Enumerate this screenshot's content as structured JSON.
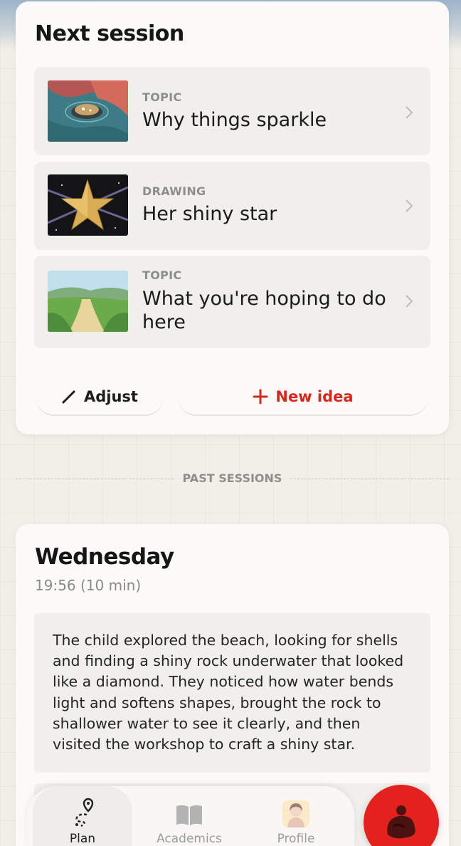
{
  "next_session": {
    "title": "Next session",
    "items": [
      {
        "kind": "TOPIC",
        "title": "Why things sparkle"
      },
      {
        "kind": "DRAWING",
        "title": "Her shiny star"
      },
      {
        "kind": "TOPIC",
        "title": "What you're hoping to do here"
      }
    ],
    "adjust_label": "Adjust",
    "new_idea_label": "New idea"
  },
  "past_sessions": {
    "label": "PAST SESSIONS",
    "sessions": [
      {
        "day": "Wednesday",
        "time": "19:56 (10 min)",
        "summary": "The child explored the beach, looking for shells and finding a shiny rock underwater that looked like a diamond. They noticed how water bends light and softens shapes, brought the rock to shallower water to see it clearly, and then visited the workshop to craft a shiny star."
      }
    ]
  },
  "nav": {
    "items": [
      {
        "label": "Plan",
        "icon": "route-pin-icon",
        "active": true
      },
      {
        "label": "Academics",
        "icon": "book-icon",
        "active": false
      },
      {
        "label": "Profile",
        "icon": "avatar-icon",
        "active": false
      }
    ],
    "fab_icon": "character-icon"
  },
  "colors": {
    "accent": "#d9261c",
    "background": "#f1efe8",
    "card": "#fbfaf8"
  }
}
